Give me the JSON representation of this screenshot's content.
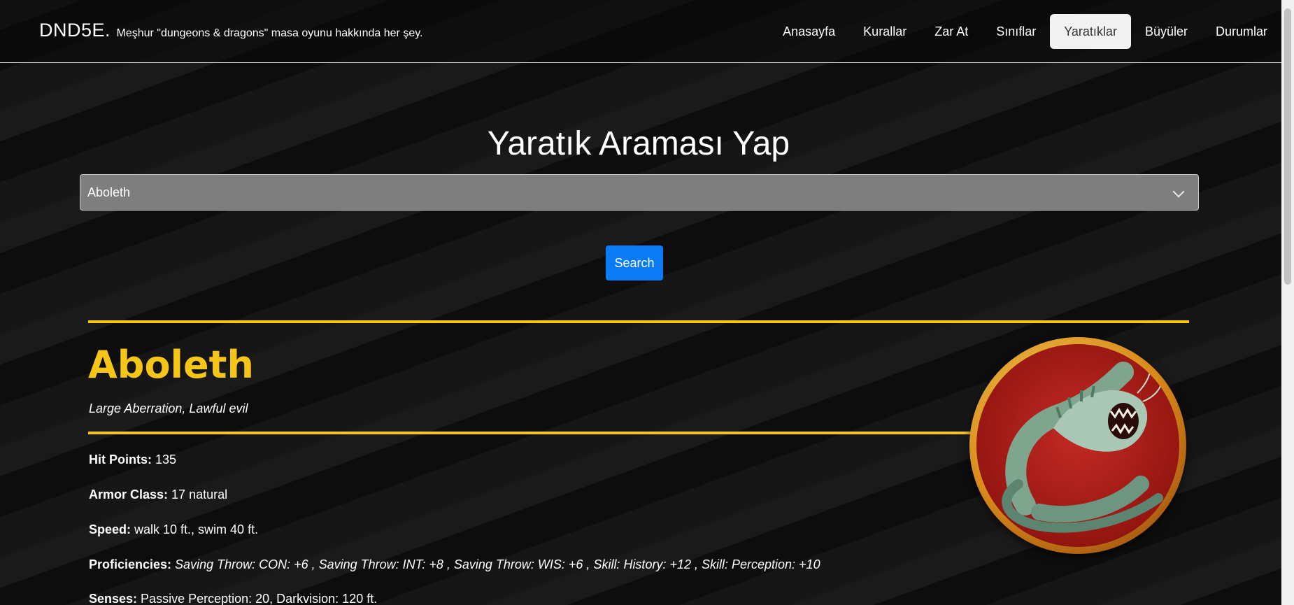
{
  "brand": {
    "name": "DND5E.",
    "tagline": "Meşhur \"dungeons & dragons\" masa oyunu hakkında her şey."
  },
  "nav": {
    "items": [
      {
        "label": "Anasayfa"
      },
      {
        "label": "Kurallar"
      },
      {
        "label": "Zar At"
      },
      {
        "label": "Sınıflar"
      },
      {
        "label": "Yaratıklar",
        "active": true
      },
      {
        "label": "Büyüler"
      },
      {
        "label": "Durumlar"
      }
    ]
  },
  "search": {
    "title": "Yaratık Araması Yap",
    "selected_value": "Aboleth",
    "button_label": "Search"
  },
  "creature": {
    "name": "Aboleth",
    "type_line": "Large Aberration, Lawful evil",
    "stats": [
      {
        "label": "Hit Points:",
        "value": " 135"
      },
      {
        "label": "Armor Class:",
        "value": " 17 natural"
      },
      {
        "label": "Speed:",
        "value": " walk 10 ft., swim 40 ft."
      },
      {
        "label": "Proficiencies:",
        "value": " Saving Throw: CON: +6 , Saving Throw: INT: +8 , Saving Throw: WIS: +6 , Skill: History: +12 , Skill: Perception: +10"
      },
      {
        "label": "Senses:",
        "value": " Passive Perception: 20, Darkvision: 120 ft."
      }
    ]
  },
  "colors": {
    "accent": "#f5c518",
    "button": "#0a7bf5",
    "background": "#121212"
  }
}
